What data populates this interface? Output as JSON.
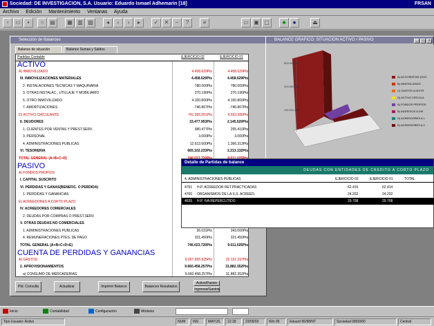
{
  "app": {
    "title": "Sociedad: DE INVESTIGACION, S.A. Usuario: Eduardo Ismael Adhemarin [18]",
    "title_right": "FRSAN"
  },
  "menu": [
    "Archivo",
    "Edición",
    "Mantenimiento",
    "Ventanas",
    "Ayuda"
  ],
  "balance_window": {
    "title": "Selección de Balances",
    "tabs": [
      "Balance de situación",
      "Balance Sumas y Saldos"
    ],
    "columns": [
      "Partidas Contable",
      "EJERCICIO 02",
      "EJERCICIO 01"
    ],
    "rows": [
      {
        "label": "ACTIVO",
        "v1": "",
        "v2": "",
        "style": "section"
      },
      {
        "label": "A) INMOVILIZADO",
        "v1": "4.458.629Pts",
        "v2": "4.458.629Pts",
        "style": "red"
      },
      {
        "label": "III. INMOVILIZACIONES MATERIALES",
        "v1": "4.458.629Pts",
        "v2": "4.458.629Pts",
        "style": "bold"
      },
      {
        "label": "2. INSTALACIONES TECNICAS Y MAQUINARIA",
        "v1": "780.000Pts",
        "v2": "780.000Pts",
        "style": "normal"
      },
      {
        "label": "3. OTRAS INSTALAC., UTILLAJE Y MOBILIARIO",
        "v1": "270.196Pts",
        "v2": "270.196Pts",
        "style": "normal"
      },
      {
        "label": "5. OTRO INMOVILIZADO",
        "v1": "4.150.800Pts",
        "v2": "4.150.800Pts",
        "style": "normal"
      },
      {
        "label": "7. AMORTIZACIONES",
        "v1": "-746.867Pts",
        "v2": "-746.867Pts",
        "style": "normal"
      },
      {
        "label": "D) ACTIVO CIRCULANTE",
        "v1": "741.565.051Pts",
        "v2": "4.553.390Pts",
        "style": "red"
      },
      {
        "label": "II. DEUDORES",
        "v1": "23.477.953Pts",
        "v2": "2.145.520Pts",
        "style": "bold"
      },
      {
        "label": "1. CLIENTES POR VENTAS Y PREST.SERV.",
        "v1": "980.477Pts",
        "v2": "255.410Pts",
        "style": "normal"
      },
      {
        "label": "3. PERSONAL",
        "v1": "3.000Pts",
        "v2": "3.000Pts",
        "style": "normal"
      },
      {
        "label": "4. ADMINISTRACIONES PUBLICAS",
        "v1": "12.613.600Pts",
        "v2": "1.366.313Pts",
        "style": "normal"
      },
      {
        "label": "VI. TESORERIA",
        "v1": "665.102.233Pts",
        "v2": "2.213.132Pts",
        "style": "bold"
      },
      {
        "label": "TOTAL GENERAL (A+B+C+D)",
        "v1": "746.023.720Pts",
        "v2": "9.011.025Pts",
        "style": "redbold"
      },
      {
        "label": "PASIVO",
        "v1": "",
        "v2": "",
        "style": "section"
      },
      {
        "label": "A) FONDOS PROPIOS",
        "v1": "",
        "v2": "",
        "style": "red"
      },
      {
        "label": "I. CAPITAL SUSCRITO",
        "v1": "",
        "v2": "",
        "style": "bold"
      },
      {
        "label": "VI. PERDIDAS Y GANAS(BENEFIC. O PERDIDA)",
        "v1": "",
        "v2": "",
        "style": "bold"
      },
      {
        "label": "1. PERDIDAS Y GANANCIAS",
        "v1": "",
        "v2": "",
        "style": "normal"
      },
      {
        "label": "E) ACREEDORES A CORTO PLAZO",
        "v1": "",
        "v2": "",
        "style": "red"
      },
      {
        "label": "IV. ACREEDORES COMERCIALES",
        "v1": "",
        "v2": "",
        "style": "bold"
      },
      {
        "label": "2. DEUDAS POR COMPRAS O PREST.SERV.",
        "v1": "",
        "v2": "",
        "style": "normal"
      },
      {
        "label": "V. OTRAS DEUDAS NO COMERCIALES",
        "v1": "",
        "v2": "",
        "style": "bold"
      },
      {
        "label": "1. ADMINISTRACIONES PUBLICAS",
        "v1": "36.031Pts",
        "v2": "343.000Pts",
        "style": "normal"
      },
      {
        "label": "4. REMUNERACIONES PTES. DE PAGO",
        "v1": "321.450Pts",
        "v2": "321.450Pts",
        "style": "normal"
      },
      {
        "label": "TOTAL GENERAL (A+B+C+D+E)",
        "v1": "746.023.720Pts",
        "v2": "9.011.025Pts",
        "style": "bold"
      },
      {
        "label": "CUENTA DE PERDIDAS Y GANANCIAS",
        "v1": "",
        "v2": "",
        "style": "section"
      },
      {
        "label": "A) GASTOS",
        "v1": "9.657.655.925Pts",
        "v2": "32.131.297Pts",
        "style": "red"
      },
      {
        "label": "2. APROVISIONAMIENTOS",
        "v1": "9.660.458.257Pts",
        "v2": "31.882.352Pts",
        "style": "bold"
      },
      {
        "label": "a) CONSUMO DE MERCADERIAS",
        "v1": "9.660.458.257Pts",
        "v2": "31.882.352Pts",
        "style": "normal"
      }
    ],
    "buttons": [
      "Ptd. Consulta",
      "Actualizar",
      "Imprimir Balance",
      "Balances Resultados",
      "Activo/Pasivo",
      "Ingresos/Gastos"
    ]
  },
  "chart_window": {
    "title": "BALANCE GRAFICO: SITUACION ACTIVO / PASIVO",
    "legend": [
      {
        "label": "A) ACCIONISTAS (SOC",
        "color": "#8b1a1a"
      },
      {
        "label": "B) INMOVILIZADO",
        "color": "#cc3300"
      },
      {
        "label": "C) GASTOS A DISTR",
        "color": "#e86a1a"
      },
      {
        "label": "D) ACTIVO CIRCULA",
        "color": "#f0e020"
      },
      {
        "label": "A) FONDOS PROPIOS",
        "color": "#7040a0"
      },
      {
        "label": "B) INGRESOS A DIS",
        "color": "#a02060"
      },
      {
        "label": "D) ACREEDORES A L",
        "color": "#208080"
      },
      {
        "label": "E) ACREEDORES A C",
        "color": "#6a1010"
      }
    ]
  },
  "detail_dialog": {
    "title": "Detalle de Partidas de balance",
    "header": "DEUDAS CON ENTIDADES DE CREDITO A CORTO PLAZO",
    "columns": [
      "4. ADMINISTRACIONES PUBLICAS",
      "EJERCICIO 02",
      "EJERCICIO 01",
      "TOTAL"
    ],
    "rows": [
      {
        "code": "4751",
        "desc": "H.P. ACREEDOR RET.PRACTICADAS",
        "v1": "62.415",
        "v2": "62.414",
        "selected": false
      },
      {
        "code": "4760",
        "desc": "ORGANISMOS DE LA S.S. ACREED.",
        "v1": "24.202",
        "v2": "24.202",
        "selected": false
      },
      {
        "code": "4635",
        "desc": "H.P. IVA REPERCUTIDO",
        "v1": "29.708",
        "v2": "29.708",
        "selected": true
      }
    ]
  },
  "taskbar": [
    "Inicio",
    "Contabilidad",
    "Configuración",
    "Módulos"
  ],
  "statusbar": [
    "Tipo Usuario: Activo",
    "NUM",
    "INS",
    "MAYUS",
    "12:18",
    "23/05/03",
    "Win 95",
    "Eduard 95/98/NT",
    "Sociedad 08/00/00",
    "Central"
  ]
}
